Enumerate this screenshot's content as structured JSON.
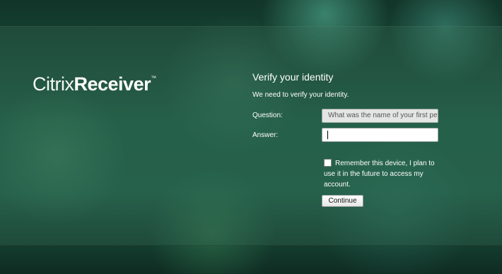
{
  "logo": {
    "brand": "Citrix",
    "product": "Receiver",
    "trademark": "™"
  },
  "form": {
    "title": "Verify your identity",
    "message": "We need to verify your identity.",
    "question_label": "Question:",
    "question_value": "What was the name of your first pet?",
    "answer_label": "Answer:",
    "answer_value": "",
    "remember_label": "Remember this device, I plan to use it in the future to access my account.",
    "remember_checked": false,
    "continue_label": "Continue"
  }
}
